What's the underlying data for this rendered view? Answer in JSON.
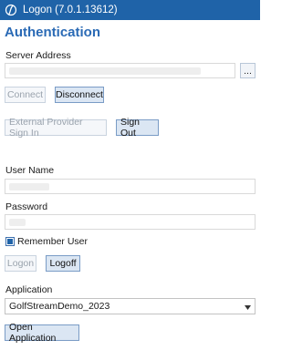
{
  "window": {
    "title": "Logon (7.0.1.13612)",
    "title_bar_color": "#1f63a8"
  },
  "authentication": {
    "heading": "Authentication",
    "heading_color": "#2a6ab5",
    "server_address": {
      "label": "Server Address",
      "value": "",
      "browse_label": "..."
    },
    "connect_label": "Connect",
    "disconnect_label": "Disconnect",
    "external_signin_label": "External Provider Sign In",
    "sign_out_label": "Sign Out",
    "user_name": {
      "label": "User Name",
      "value": ""
    },
    "password": {
      "label": "Password",
      "value": ""
    },
    "remember_user": {
      "label": "Remember User",
      "checked": true
    },
    "logon_label": "Logon",
    "logoff_label": "Logoff",
    "application": {
      "label": "Application",
      "selected": "GolfStreamDemo_2023"
    },
    "open_application_label": "Open Application"
  }
}
